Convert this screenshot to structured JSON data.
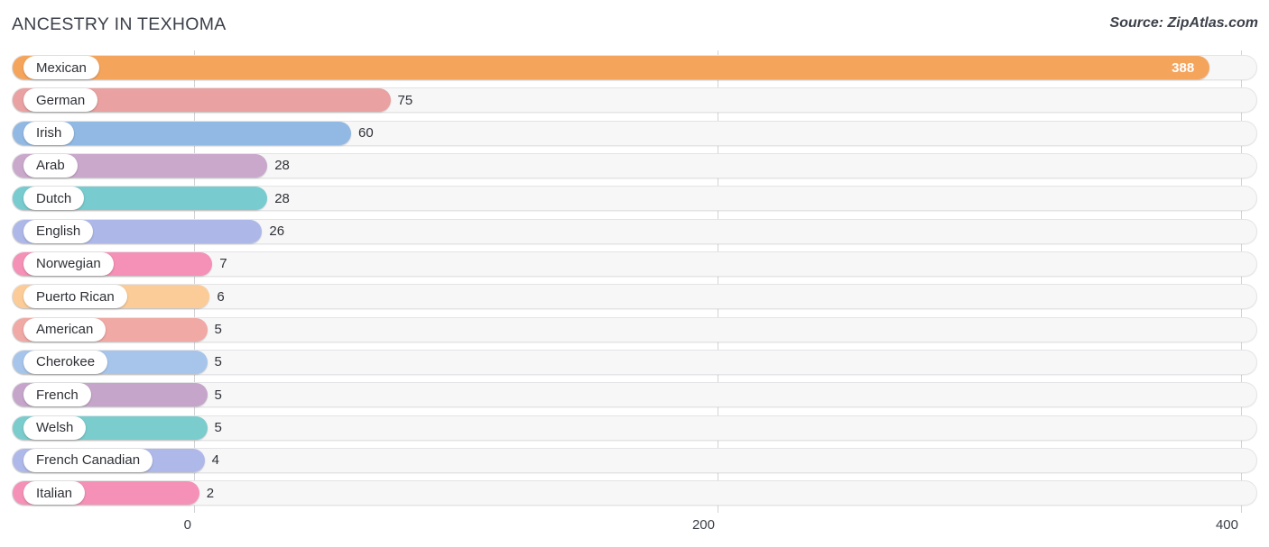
{
  "header": {
    "title": "ANCESTRY IN TEXHOMA",
    "source": "Source: ZipAtlas.com"
  },
  "chart_data": {
    "type": "bar",
    "orientation": "horizontal",
    "title": "ANCESTRY IN TEXHOMA",
    "subtitle": "",
    "xlabel": "",
    "ylabel": "",
    "xlim": [
      0,
      400
    ],
    "grid": true,
    "gridlines": [
      0,
      200,
      400
    ],
    "tick_labels": [
      "0",
      "200",
      "400"
    ],
    "legend": "none",
    "categories": [
      "Mexican",
      "German",
      "Irish",
      "Arab",
      "Dutch",
      "English",
      "Norwegian",
      "Puerto Rican",
      "American",
      "Cherokee",
      "French",
      "Welsh",
      "French Canadian",
      "Italian"
    ],
    "values": [
      388,
      75,
      60,
      28,
      28,
      26,
      7,
      6,
      5,
      5,
      5,
      5,
      4,
      2
    ],
    "value_labels": [
      "388",
      "75",
      "60",
      "28",
      "28",
      "26",
      "7",
      "6",
      "5",
      "5",
      "5",
      "5",
      "4",
      "2"
    ],
    "colors": [
      "#f5a45c",
      "#e9a1a1",
      "#92b9e3",
      "#c9a8cc",
      "#78cbce",
      "#aeb8e8",
      "#f590b6",
      "#fbcc97",
      "#f0a9a4",
      "#a7c5ea",
      "#c6a5ca",
      "#7bcccd",
      "#afb9e9",
      "#f591b7"
    ],
    "bars": [
      {
        "label": "Mexican",
        "value": 388,
        "display": "388",
        "color": "#f5a45c",
        "label_inside_bar": true
      },
      {
        "label": "German",
        "value": 75,
        "display": "75",
        "color": "#e9a1a1",
        "label_inside_bar": false
      },
      {
        "label": "Irish",
        "value": 60,
        "display": "60",
        "color": "#92b9e3",
        "label_inside_bar": false
      },
      {
        "label": "Arab",
        "value": 28,
        "display": "28",
        "color": "#c9a8cc",
        "label_inside_bar": false
      },
      {
        "label": "Dutch",
        "value": 28,
        "display": "28",
        "color": "#78cbce",
        "label_inside_bar": false
      },
      {
        "label": "English",
        "value": 26,
        "display": "26",
        "color": "#aeb8e8",
        "label_inside_bar": false
      },
      {
        "label": "Norwegian",
        "value": 7,
        "display": "7",
        "color": "#f590b6",
        "label_inside_bar": false
      },
      {
        "label": "Puerto Rican",
        "value": 6,
        "display": "6",
        "color": "#fbcc97",
        "label_inside_bar": false
      },
      {
        "label": "American",
        "value": 5,
        "display": "5",
        "color": "#f0a9a4",
        "label_inside_bar": false
      },
      {
        "label": "Cherokee",
        "value": 5,
        "display": "5",
        "color": "#a7c5ea",
        "label_inside_bar": false
      },
      {
        "label": "French",
        "value": 5,
        "display": "5",
        "color": "#c6a5ca",
        "label_inside_bar": false
      },
      {
        "label": "Welsh",
        "value": 5,
        "display": "5",
        "color": "#7bcccd",
        "label_inside_bar": false
      },
      {
        "label": "French Canadian",
        "value": 4,
        "display": "4",
        "color": "#afb9e9",
        "label_inside_bar": false
      },
      {
        "label": "Italian",
        "value": 2,
        "display": "2",
        "color": "#f591b7",
        "label_inside_bar": false
      }
    ]
  }
}
